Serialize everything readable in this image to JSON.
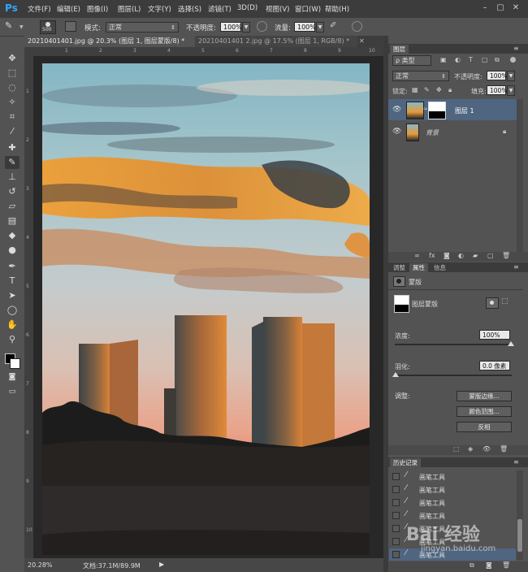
{
  "app": {
    "logo": "Ps",
    "menu": [
      "文件(F)",
      "编辑(E)",
      "图像(I)",
      "图层(L)",
      "文字(Y)",
      "选择(S)",
      "滤镜(T)",
      "3D(D)",
      "视图(V)",
      "窗口(W)",
      "帮助(H)"
    ]
  },
  "options": {
    "brush_size": "500",
    "mode_label": "模式:",
    "mode_value": "正常",
    "opacity_label": "不透明度:",
    "opacity_value": "100%",
    "flow_label": "流量:",
    "flow_value": "100%"
  },
  "tabs": [
    {
      "label": "20210401401.jpg @ 20.3% (图层 1, 图层蒙版/8) *",
      "active": true
    },
    {
      "label": "20210401401 2.jpg @ 17.5% (图层 1, RGB/8) *",
      "active": false
    }
  ],
  "ruler": {
    "top": [
      "1",
      "2",
      "3",
      "4",
      "5",
      "6",
      "7",
      "8",
      "9",
      "10"
    ],
    "left": [
      "1",
      "2",
      "3",
      "4",
      "5",
      "6",
      "7",
      "8",
      "9",
      "10"
    ]
  },
  "status": {
    "zoom": "20.28%",
    "doc": "文档:37.1M/89.9M"
  },
  "layers_panel": {
    "title": "图层",
    "filter_label": "ρ 类型",
    "blend_mode": "正常",
    "opacity_label": "不透明度:",
    "opacity_value": "100%",
    "lock_label": "锁定:",
    "fill_label": "填充:",
    "fill_value": "100%",
    "layers": [
      {
        "name": "图层 1",
        "selected": true
      },
      {
        "name": "背景",
        "selected": false
      }
    ]
  },
  "properties_panel": {
    "tabs": [
      "调整",
      "属性",
      "信息"
    ],
    "active_tab": "属性",
    "section": "蒙版",
    "mask_label": "图层蒙版",
    "density_label": "浓度:",
    "density_value": "100%",
    "feather_label": "羽化:",
    "feather_value": "0.0 像素",
    "adjust_label": "调整:",
    "buttons": [
      "蒙版边缘...",
      "颜色范围...",
      "反相"
    ]
  },
  "history_panel": {
    "title": "历史记录",
    "items": [
      "画笔工具",
      "画笔工具",
      "画笔工具",
      "画笔工具",
      "画笔工具",
      "画笔工具",
      "画笔工具"
    ]
  },
  "watermark": {
    "text": "Bai 经验",
    "url": "jingyan.baidu.com"
  },
  "colors": {
    "accent": "#31a8ff",
    "panel": "#535353",
    "dark": "#3b3b3b",
    "selected_layer": "#4f6580"
  }
}
